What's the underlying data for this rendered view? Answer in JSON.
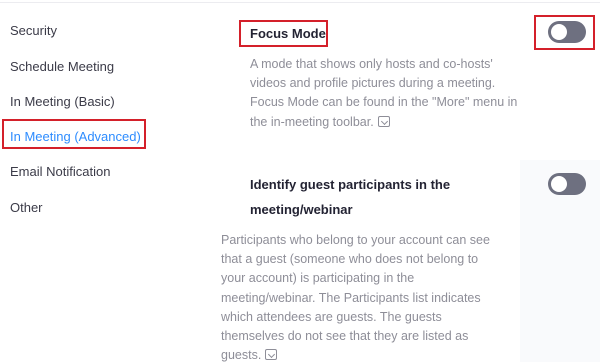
{
  "sidebar": {
    "items": [
      {
        "label": "Security",
        "active": false
      },
      {
        "label": "Schedule Meeting",
        "active": false
      },
      {
        "label": "In Meeting (Basic)",
        "active": false
      },
      {
        "label": "In Meeting (Advanced)",
        "active": true
      },
      {
        "label": "Email Notification",
        "active": false
      },
      {
        "label": "Other",
        "active": false
      }
    ]
  },
  "settings": [
    {
      "title": "Focus Mode",
      "description": "A mode that shows only hosts and co-hosts' videos and profile pictures during a meeting. Focus Mode can be found in the \"More\" menu in the in-meeting toolbar.",
      "enabled": false
    },
    {
      "title_line1": "Identify guest participants in the",
      "title_line2": "meeting/webinar",
      "description": "Participants who belong to your account can see that a guest (someone who does not belong to your account) is participating in the meeting/webinar. The Participants list indicates which attendees are guests. The guests themselves do not see that they are listed as guests.",
      "enabled": false
    }
  ],
  "colors": {
    "accent": "#2d8cff",
    "highlight": "#d4202a",
    "toggle_off": "#6e7080",
    "description_text": "#8e8e98"
  },
  "icons": {
    "info": "info-icon"
  }
}
